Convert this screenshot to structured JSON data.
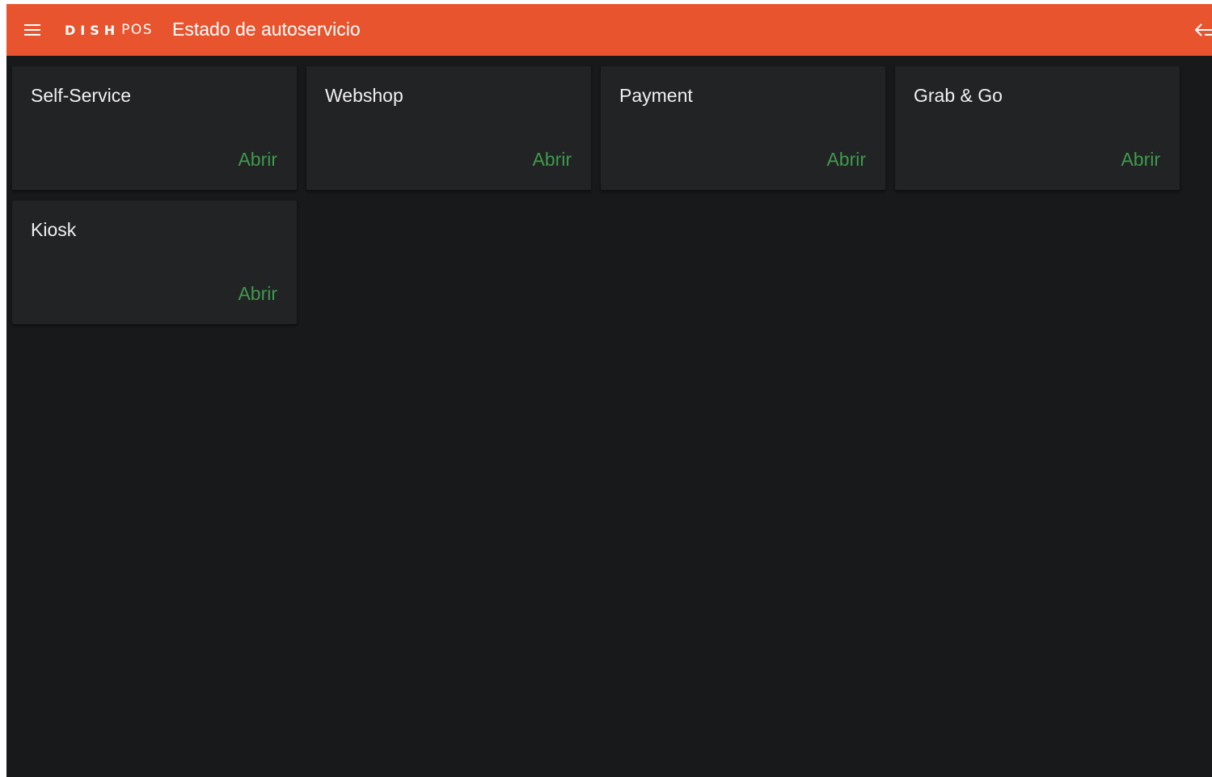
{
  "header": {
    "brand_primary": "DISH",
    "brand_secondary": "POS",
    "title": "Estado de autoservicio",
    "menu_icon": "hamburger-menu-icon",
    "exit_icon": "logout-arrow-icon",
    "background_color": "#e8542e"
  },
  "cards": [
    {
      "title": "Self-Service",
      "action": "Abrir"
    },
    {
      "title": "Webshop",
      "action": "Abrir"
    },
    {
      "title": "Payment",
      "action": "Abrir"
    },
    {
      "title": "Grab & Go",
      "action": "Abrir"
    },
    {
      "title": "Kiosk",
      "action": "Abrir"
    }
  ],
  "colors": {
    "background": "#18191b",
    "card": "#222325",
    "action_text": "#3f9a4c",
    "title_text": "#f0f0f0"
  }
}
